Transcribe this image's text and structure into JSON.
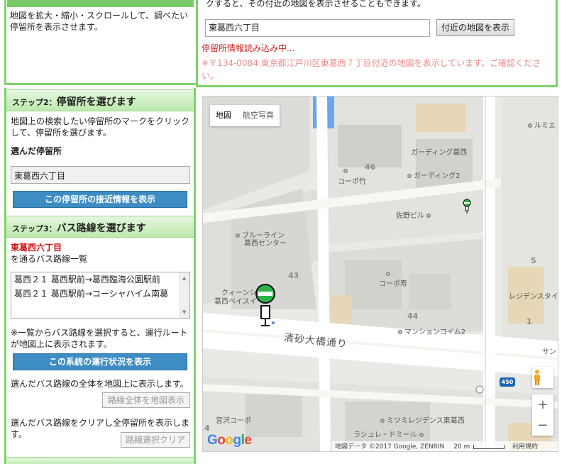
{
  "step1": {
    "text": "地図を拡大・縮小・スクロールして、調べたい停留所を表示させます。"
  },
  "search": {
    "hint": "クすると、その付近の地図を表示させることもできます。",
    "input_value": "東葛西六丁目",
    "button_label": "付近の地図を表示",
    "loading": "停留所情報読み込み中...",
    "confirm": "※〒134-0084 東京都江戸川区東葛西７丁目付近の地図を表示しています。ご確認ください。"
  },
  "step2": {
    "label_small": "ステップ2：",
    "label_big": "停留所を選びます",
    "instruction": "地図上の検索したい停留所のマークをクリックして、停留所を選びます。",
    "selected_label": "選んだ停留所",
    "selected_value": "東葛西六丁目",
    "approach_button": "この停留所の接近情報を表示"
  },
  "step3": {
    "label_small": "ステップ3：",
    "label_big": "バス路線を選びます",
    "stop_name": "東葛西六丁目",
    "through_text": "を通るバス路線一覧",
    "routes": [
      "葛西２１ 葛西駅前→葛西臨海公園駅前",
      "葛西２１ 葛西駅前→コーシャハイム南葛"
    ],
    "note": "※一覧からバス路線を選択すると、運行ルートが地図上に表示されます。",
    "status_button": "この系統の運行状況を表示",
    "show_all_text": "選んだバス路線の全体を地図上に表示します。",
    "show_all_button": "路線全体を地図表示",
    "clear_text": "選んだバス路線をクリアし全停留所を表示します。",
    "clear_button": "路線選択クリア"
  },
  "map": {
    "type_map": "地図",
    "type_satellite": "航空写真",
    "road": "清砂大橋通り",
    "route_badge": "450",
    "attribution": "地図データ ©2017 Google, ZENRIN",
    "scale": "20 m",
    "terms": "利用規約",
    "logo": "Google",
    "blocks": {
      "b46": "46",
      "b43": "43",
      "b44": "44",
      "b5": "5",
      "b1": "1",
      "b4": "4"
    },
    "places": {
      "lumie": "ルミエ",
      "garden_kasai": "ガーディング葛西",
      "garden2": "ガーディング2",
      "copo_take": "コーポ竹",
      "sano": "佐野ビル",
      "blueline1": "ブルーライン",
      "blueline2": "葛西センター",
      "quince1": "クィーンシ",
      "quince2": "葛西ベイスイ",
      "copo_kotobuki": "コーポ寿",
      "mansion": "マンションコイム2",
      "residence": "レジデンスタイ",
      "sun": "サン",
      "miyazawa": "宮沢コーポ",
      "mitsumi": "ミツミレジデンス東葛西",
      "lasile": "ラシュレ・ドミール"
    }
  },
  "colors": {
    "green_border": "#7ed36a",
    "blue_button": "#3d8dc4",
    "red_text": "#cc1111",
    "stop_marker": "#22aa44"
  }
}
